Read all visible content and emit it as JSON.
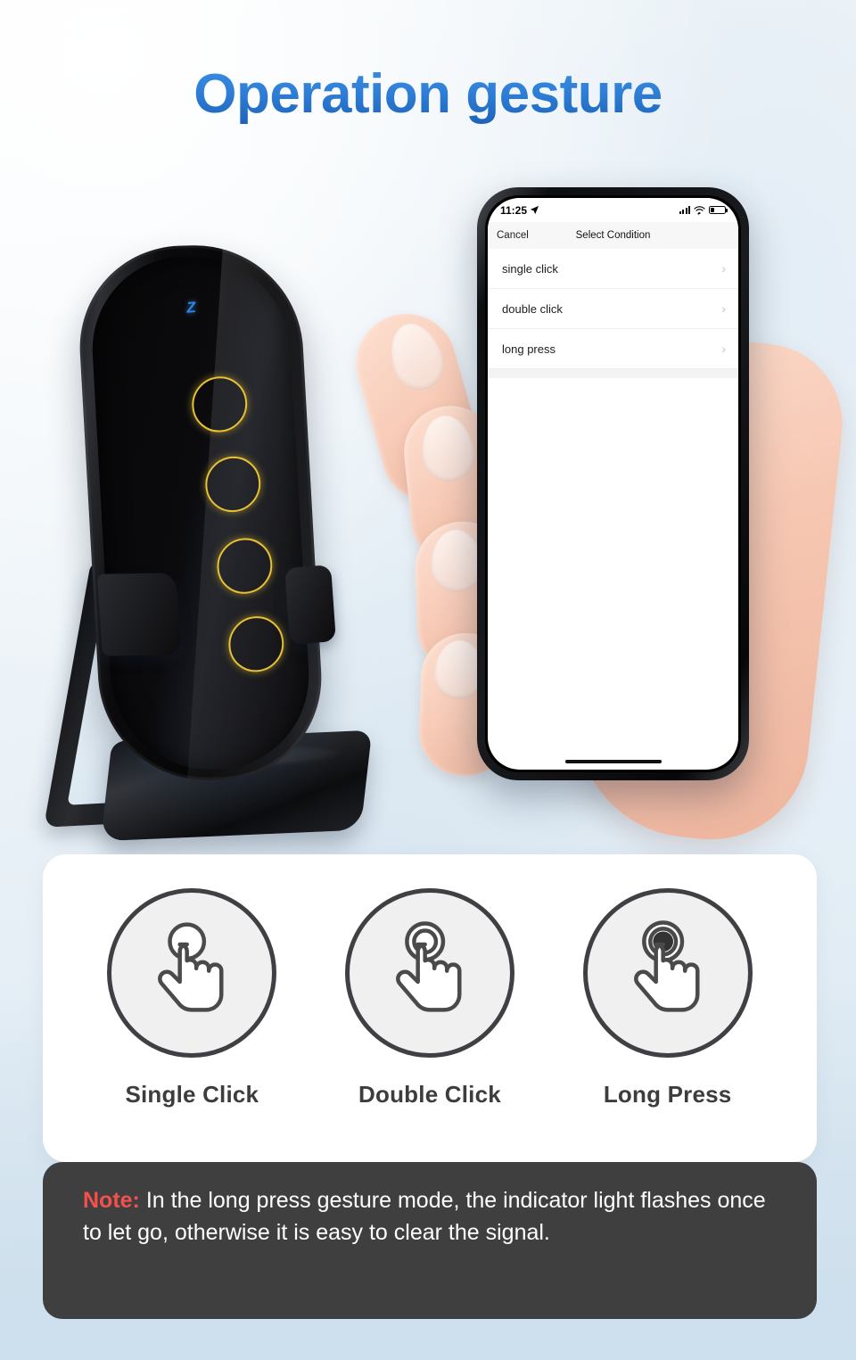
{
  "header": {
    "title": "Operation gesture"
  },
  "device": {
    "logo": "Z",
    "touch_ring_color": "#e8c233",
    "logo_color": "#2f86e0"
  },
  "phone": {
    "status_bar": {
      "time": "11:25",
      "location_icon": "location-arrow-icon",
      "signal_icon": "cellular-signal-icon",
      "wifi_icon": "wifi-icon",
      "battery_icon": "battery-icon"
    },
    "nav": {
      "cancel_label": "Cancel",
      "title": "Select Condition"
    },
    "list": [
      {
        "label": "single click",
        "chevron": "›"
      },
      {
        "label": "double click",
        "chevron": "›"
      },
      {
        "label": "long press",
        "chevron": "›"
      }
    ]
  },
  "gestures": [
    {
      "label": "Single Click",
      "icon": "hand-tap-single-icon"
    },
    {
      "label": "Double Click",
      "icon": "hand-tap-double-icon"
    },
    {
      "label": "Long Press",
      "icon": "hand-tap-hold-icon"
    }
  ],
  "note": {
    "label": "Note:",
    "text": "In the long press gesture mode, the indicator light flashes once to let go, otherwise it is easy to clear the signal."
  },
  "colors": {
    "title_blue": "#2f7fd8",
    "note_bg": "#3f3f3f",
    "note_label_red": "#f5504d",
    "card_bg": "#ffffff",
    "icon_stroke": "#3f4043",
    "icon_fill": "#f0f0f0"
  }
}
